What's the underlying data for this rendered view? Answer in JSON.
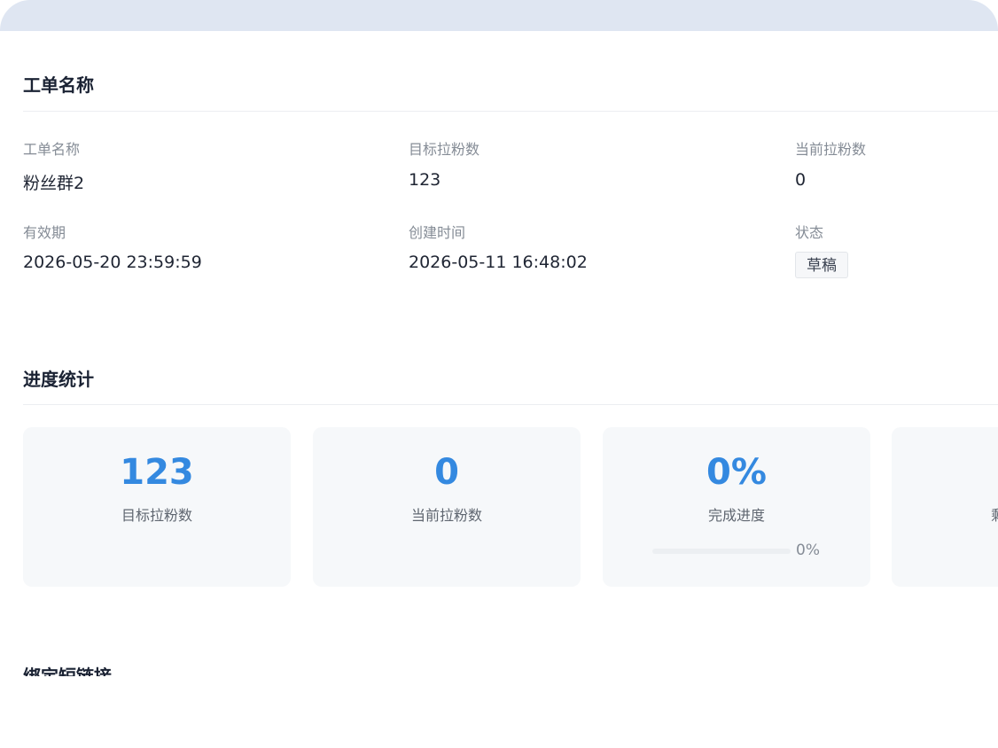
{
  "basic_info": {
    "title": "工单名称",
    "fields": {
      "name": {
        "label": "工单名称",
        "value": "粉丝群2"
      },
      "target": {
        "label": "目标拉粉数",
        "value": "123"
      },
      "current": {
        "label": "当前拉粉数",
        "value": "0"
      },
      "validity": {
        "label": "有效期",
        "value": "2026-05-20 23:59:59"
      },
      "created": {
        "label": "创建时间",
        "value": "2026-05-11 16:48:02"
      },
      "status": {
        "label": "状态",
        "value": "草稿"
      }
    }
  },
  "progress": {
    "title": "进度统计",
    "cards": [
      {
        "value": "123",
        "label": "目标拉粉数"
      },
      {
        "value": "0",
        "label": "当前拉粉数"
      },
      {
        "value": "0%",
        "label": "完成进度",
        "progress_percent": 0,
        "progress_text": "0%"
      },
      {
        "value": "",
        "label": "剩"
      }
    ]
  },
  "next_section": {
    "title": "绑定短链接"
  },
  "colors": {
    "accent": "#3489e0",
    "card_bg": "#f6f8fa",
    "header_band": "#dfe6f2"
  }
}
